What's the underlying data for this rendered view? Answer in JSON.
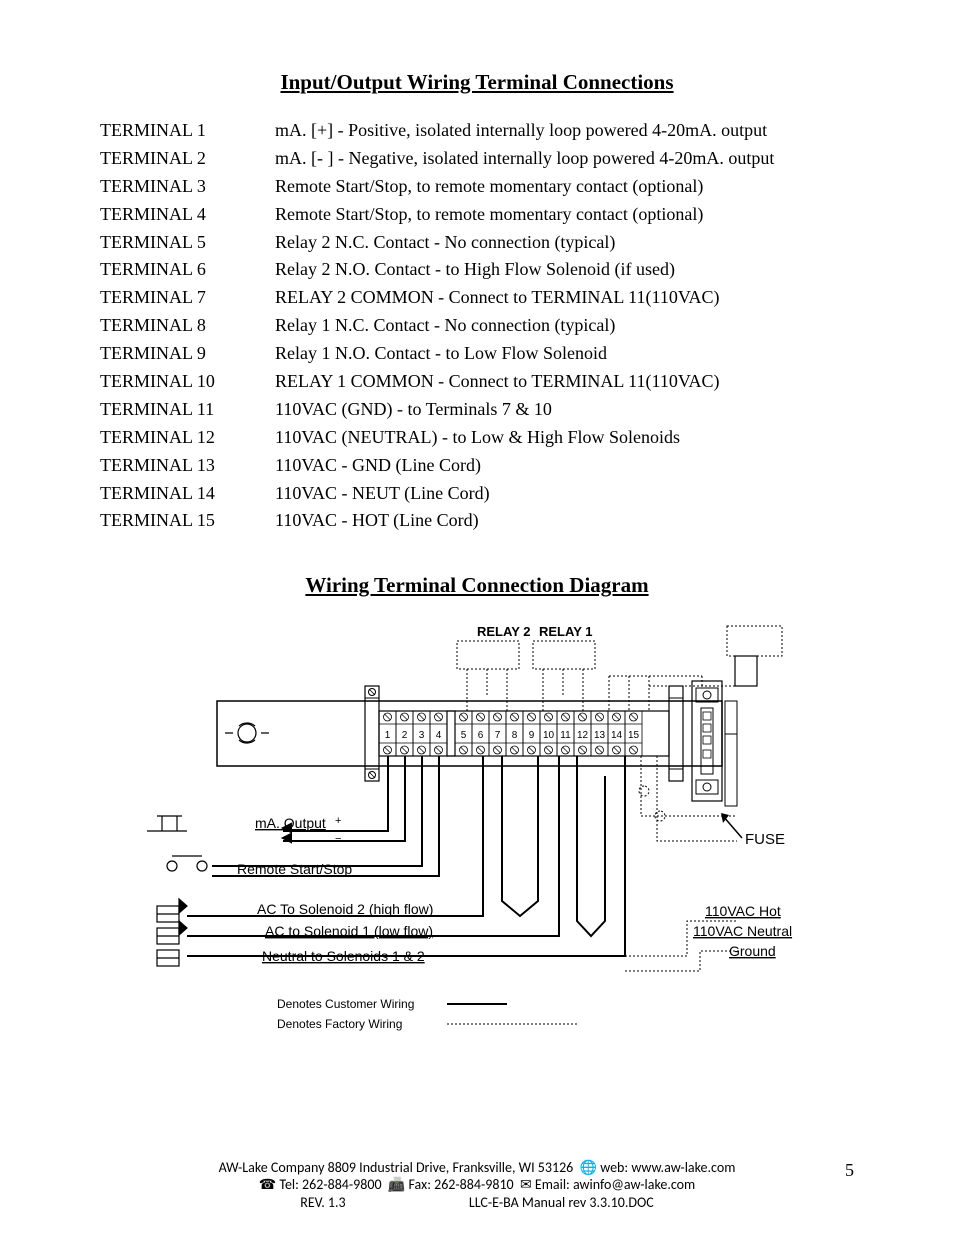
{
  "title1": "Input/Output Wiring Terminal Connections",
  "title2": "Wiring Terminal Connection Diagram",
  "terminals": [
    {
      "label": "TERMINAL 1",
      "desc": "mA. [+] - Positive, isolated internally loop powered 4-20mA. output"
    },
    {
      "label": "TERMINAL 2",
      "desc": "mA. [- ] - Negative, isolated internally loop powered 4-20mA. output"
    },
    {
      "label": "TERMINAL 3",
      "desc": "Remote Start/Stop, to remote momentary contact (optional)"
    },
    {
      "label": "TERMINAL 4",
      "desc": "Remote Start/Stop, to remote momentary contact (optional)"
    },
    {
      "label": "TERMINAL 5",
      "desc": "Relay 2 N.C. Contact - No connection (typical)"
    },
    {
      "label": "TERMINAL 6",
      "desc": "Relay 2 N.O. Contact -  to High Flow Solenoid (if used)"
    },
    {
      "label": "TERMINAL 7",
      "desc": "RELAY 2 COMMON - Connect to TERMINAL 11(110VAC)"
    },
    {
      "label": "TERMINAL 8",
      "desc": "Relay 1 N.C. Contact - No connection (typical)"
    },
    {
      "label": "TERMINAL 9",
      "desc": "Relay 1 N.O. Contact -  to Low Flow Solenoid"
    },
    {
      "label": "TERMINAL 10",
      "desc": "RELAY 1 COMMON - Connect to  TERMINAL 11(110VAC)"
    },
    {
      "label": "TERMINAL 11",
      "desc": "110VAC (GND) - to Terminals 7 & 10"
    },
    {
      "label": "TERMINAL 12",
      "desc": "110VAC (NEUTRAL) - to Low & High Flow Solenoids"
    },
    {
      "label": "TERMINAL 13",
      "desc": "110VAC - GND (Line Cord)"
    },
    {
      "label": "TERMINAL 14",
      "desc": "110VAC - NEUT (Line Cord)"
    },
    {
      "label": "TERMINAL 15",
      "desc": "110VAC - HOT (Line Cord)"
    }
  ],
  "diagram": {
    "relay2": "RELAY 2",
    "relay1": "RELAY 1",
    "terminalNumbers": [
      "1",
      "2",
      "3",
      "4",
      "5",
      "6",
      "7",
      "8",
      "9",
      "10",
      "11",
      "12",
      "13",
      "14",
      "15"
    ],
    "maOutput": "mA. Output",
    "remoteStartStop": "Remote Start/Stop",
    "acSolenoid2": "AC To Solenoid 2 (high flow)",
    "acSolenoid1": "AC to Solenoid 1 (low flow)",
    "neutralSolenoids": "Neutral to Solenoids 1 & 2",
    "fuse": "FUSE",
    "hot": "110VAC Hot",
    "neutral": "110VAC Neutral",
    "ground": "Ground",
    "legendCustomer": "Denotes Customer Wiring",
    "legendFactory": "Denotes Factory Wiring"
  },
  "footer": {
    "line1_company": "AW-Lake Company 8809 Industrial Drive, Franksville, WI 53126",
    "line1_web": "web: www.aw-lake.com",
    "line2_tel": "Tel:  262-884-9800",
    "line2_fax": "Fax:  262-884-9810",
    "line2_email": "Email: awinfo@aw-lake.com",
    "line3_rev": "REV. 1.3",
    "line3_doc": "LLC-E-BA Manual rev 3.3.10.DOC",
    "pageNumber": "5"
  }
}
